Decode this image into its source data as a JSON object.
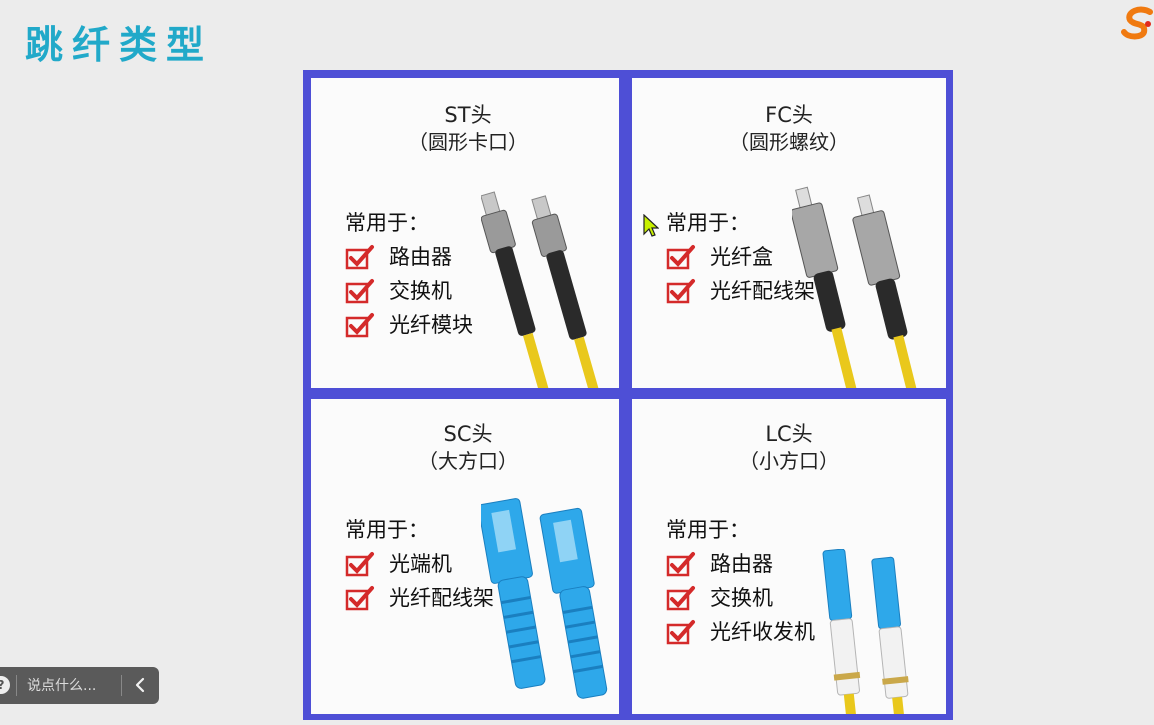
{
  "slide": {
    "title": "跳纤类型"
  },
  "panels": [
    {
      "title": "ST头",
      "subtitle": "（圆形卡口）",
      "usage_label": "常用于：",
      "items": [
        "路由器",
        "交换机",
        "光纤模块"
      ]
    },
    {
      "title": "FC头",
      "subtitle": "（圆形螺纹）",
      "usage_label": "常用于：",
      "items": [
        "光纤盒",
        "光纤配线架"
      ]
    },
    {
      "title": "SC头",
      "subtitle": "（大方口）",
      "usage_label": "常用于：",
      "items": [
        "光端机",
        "光纤配线架"
      ]
    },
    {
      "title": "LC头",
      "subtitle": "（小方口）",
      "usage_label": "常用于：",
      "items": [
        "路由器",
        "交换机",
        "光纤收发机"
      ]
    }
  ],
  "comment_bar": {
    "placeholder": "说点什么..."
  },
  "colors": {
    "title": "#21a9c9",
    "frame": "#4e4fd6",
    "check": "#d42a2a",
    "cable": "#e9c81c",
    "sc_blue": "#2ea8ea"
  },
  "icons": [
    "check-icon",
    "cursor-icon",
    "chevron-left-icon",
    "brand-logo"
  ]
}
